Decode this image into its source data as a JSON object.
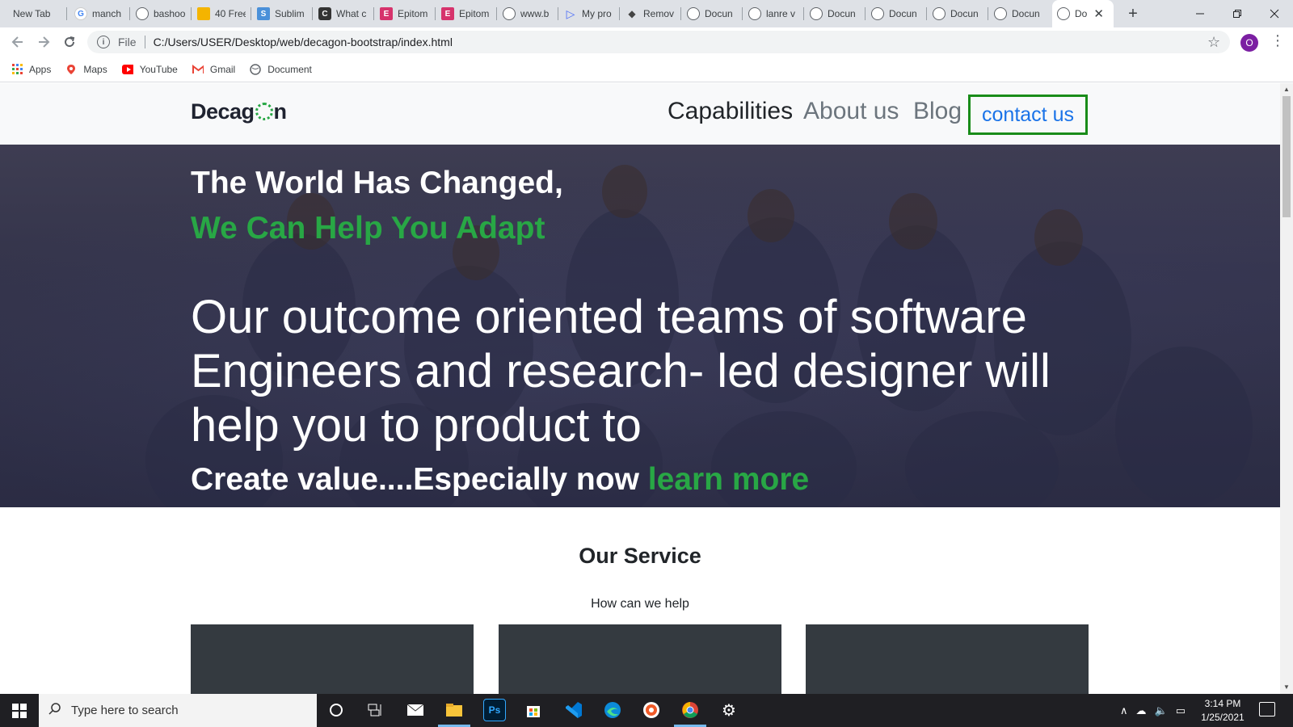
{
  "browser": {
    "tabs": [
      {
        "label": "New Tab",
        "icon": "none"
      },
      {
        "label": "manch",
        "icon": "google-icon"
      },
      {
        "label": "bashoo",
        "icon": "globe-icon"
      },
      {
        "label": "40 Free",
        "icon": "chart-icon"
      },
      {
        "label": "Sublim",
        "icon": "sublime-icon"
      },
      {
        "label": "What c",
        "icon": "app-icon"
      },
      {
        "label": "Epitom",
        "icon": "epitome-icon"
      },
      {
        "label": "Epitom",
        "icon": "epitome-icon"
      },
      {
        "label": "www.b",
        "icon": "globe-icon"
      },
      {
        "label": "My pro",
        "icon": "play-icon"
      },
      {
        "label": "Remov",
        "icon": "cap-icon"
      },
      {
        "label": "Docun",
        "icon": "globe-icon"
      },
      {
        "label": "lanre v",
        "icon": "globe-icon"
      },
      {
        "label": "Docun",
        "icon": "globe-icon"
      },
      {
        "label": "Docun",
        "icon": "globe-icon"
      },
      {
        "label": "Docun",
        "icon": "globe-icon"
      },
      {
        "label": "Docun",
        "icon": "globe-icon"
      },
      {
        "label": "Do",
        "icon": "globe-icon",
        "active": true
      }
    ],
    "close_glyph": "✕",
    "new_tab_glyph": "+",
    "address": {
      "scheme_label": "File",
      "url": "C:/Users/USER/Desktop/web/decagon-bootstrap/index.html"
    },
    "profile_initial": "O",
    "bookmarks": [
      {
        "label": "Apps",
        "icon": "apps-grid-icon"
      },
      {
        "label": "Maps",
        "icon": "maps-icon"
      },
      {
        "label": "YouTube",
        "icon": "youtube-icon"
      },
      {
        "label": "Gmail",
        "icon": "gmail-icon"
      },
      {
        "label": "Document",
        "icon": "globe-icon"
      }
    ]
  },
  "site": {
    "logo_left": "Decag",
    "logo_right": "n",
    "nav": {
      "capabilities": "Capabilities",
      "about": "About us",
      "blog": "Blog",
      "contact": "contact us"
    },
    "hero": {
      "title": "The World Has Changed,",
      "subtitle": "We Can Help You Adapt",
      "body": "Our outcome oriented teams of software Engineers and research- led designer will help you to product to",
      "cta_text": "Create value....Especially now",
      "cta_link": "learn more"
    },
    "services": {
      "title": "Our Service",
      "subtitle": "How can we help"
    },
    "colors": {
      "accent_green": "#28a745",
      "contact_border": "#198c19",
      "contact_text": "#1a73e8",
      "card_bg": "#343a40"
    }
  },
  "taskbar": {
    "search_placeholder": "Type here to search",
    "time": "3:14 PM",
    "date": "1/25/2021",
    "pinned": [
      "task-view-icon",
      "mail-icon",
      "file-explorer-icon",
      "photoshop-icon",
      "store-icon",
      "vscode-icon",
      "edge-icon",
      "media-icon",
      "chrome-icon",
      "settings-icon"
    ]
  }
}
